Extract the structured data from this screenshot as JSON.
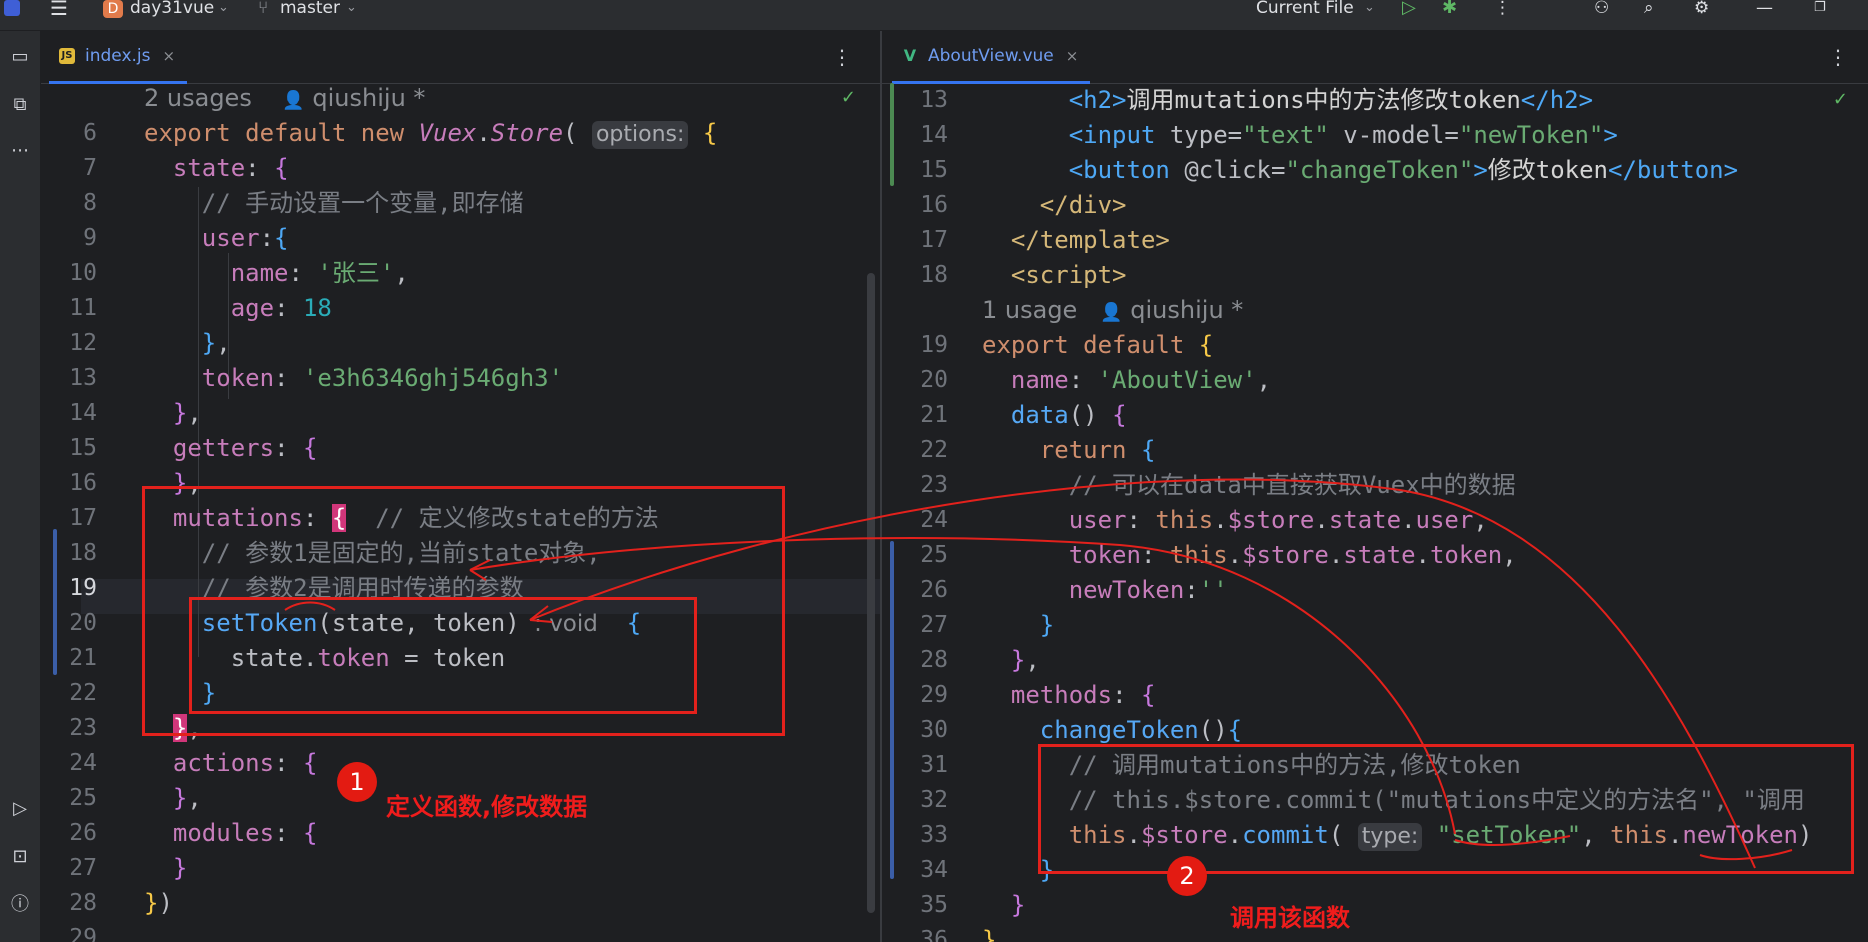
{
  "titlebar": {
    "project_initial": "D",
    "project": "day31vue",
    "branch": "master",
    "run_config": "Current File"
  },
  "left_editor": {
    "tab": {
      "icon": "JS",
      "label": "index.js",
      "close": "×"
    },
    "header_hint": {
      "usages": "2 usages",
      "author": "qiushiju *"
    }
  },
  "right_editor": {
    "tab": {
      "icon": "V",
      "label": "AboutView.vue",
      "close": "×"
    },
    "hint": {
      "usages": "1 usage",
      "author": "qiushiju *"
    }
  },
  "annotations": {
    "badge1": "1",
    "label1": "定义函数,修改数据",
    "badge2": "2",
    "label2": "调用该函数"
  },
  "colors": {
    "accent": "#3574f0",
    "annotation_red": "#e3211c"
  }
}
